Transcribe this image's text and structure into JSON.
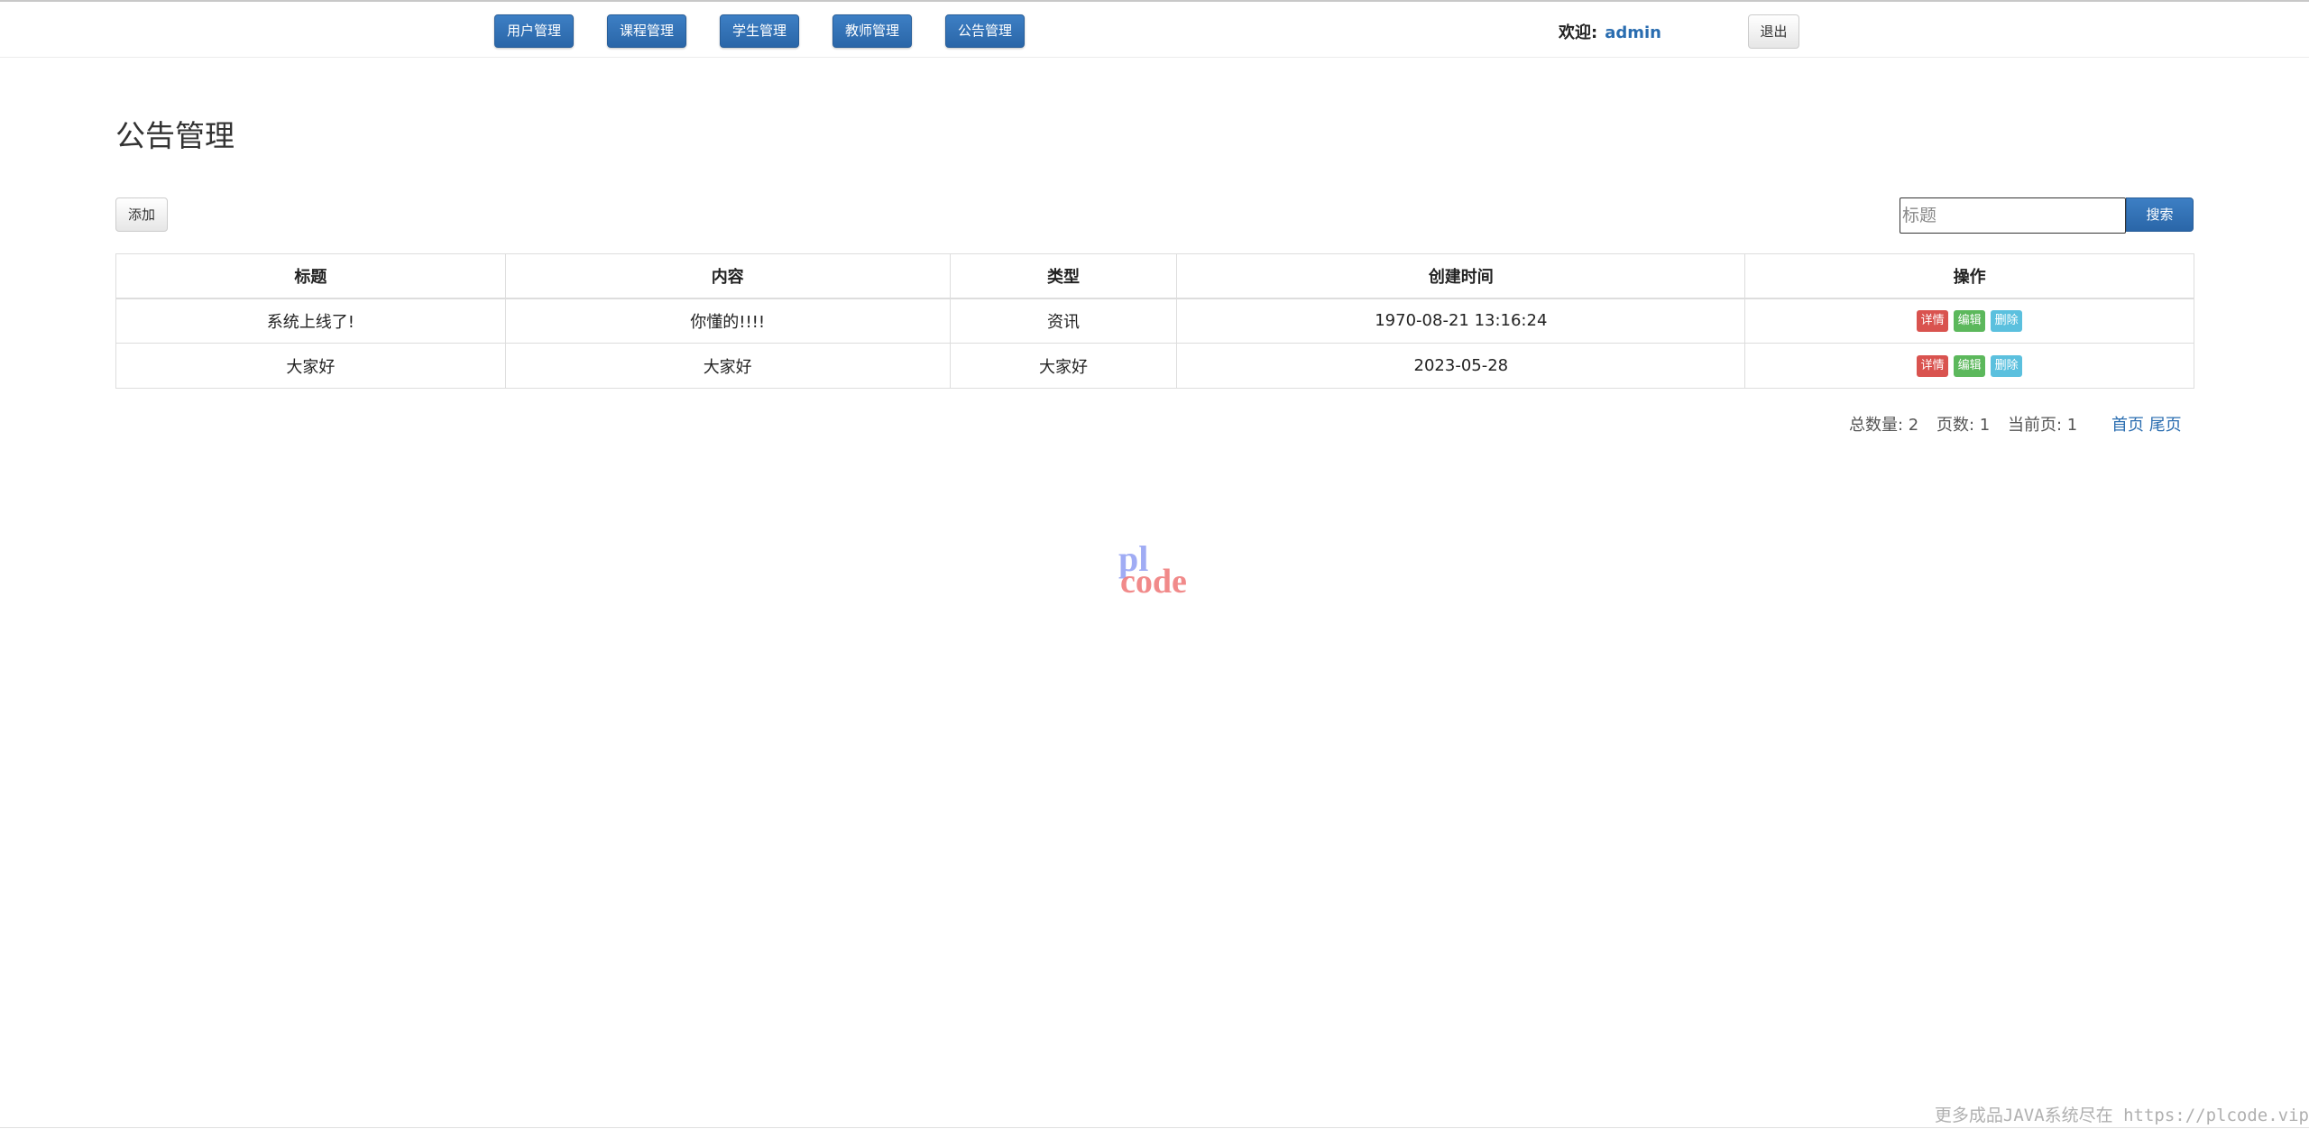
{
  "nav": {
    "items": [
      "用户管理",
      "课程管理",
      "学生管理",
      "教师管理",
      "公告管理"
    ],
    "welcome_label": "欢迎:",
    "username": "admin",
    "logout_label": "退出"
  },
  "page": {
    "title": "公告管理"
  },
  "toolbar": {
    "add_label": "添加",
    "search_placeholder": "标题",
    "search_label": "搜索"
  },
  "table": {
    "headers": [
      "标题",
      "内容",
      "类型",
      "创建时间",
      "操作"
    ],
    "rows": [
      {
        "title": "系统上线了!",
        "content": "你懂的!!!!",
        "type": "资讯",
        "created": "1970-08-21 13:16:24"
      },
      {
        "title": "大家好",
        "content": "大家好",
        "type": "大家好",
        "created": "2023-05-28"
      }
    ],
    "actions": {
      "detail": "详情",
      "edit": "编辑",
      "delete": "删除"
    }
  },
  "pager": {
    "total_label": "总数量: 2",
    "pages_label": "页数: 1",
    "current_label": "当前页: 1",
    "first_label": "首页",
    "last_label": "尾页"
  },
  "watermark": {
    "logo_top": "pl",
    "logo_bottom": "code",
    "footer_text": "更多成品JAVA系统尽在 https://plcode.vip"
  },
  "colors": {
    "primary": "#2a66a8",
    "danger": "#d9534f",
    "success": "#5cb85c",
    "info": "#5bc0de",
    "link": "#2a6db0"
  }
}
